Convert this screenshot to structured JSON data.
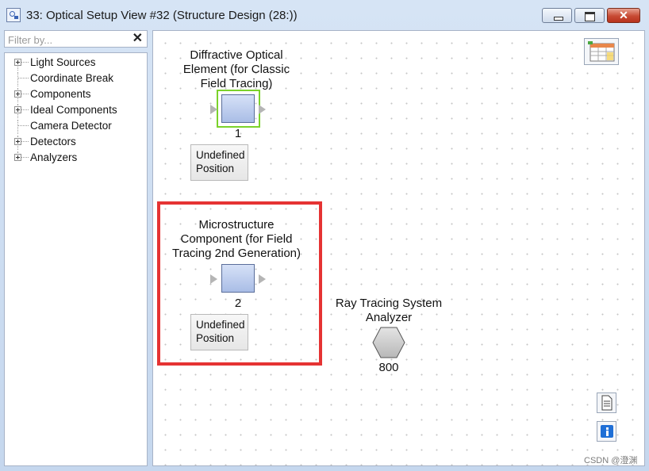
{
  "window": {
    "title": "33: Optical Setup View #32 (Structure Design (28:))",
    "buttons": {
      "minimize": "minimize",
      "maximize": "maximize",
      "close": "✕"
    }
  },
  "filter": {
    "placeholder": "Filter by...",
    "clear_symbol": "✕"
  },
  "tree": {
    "items": [
      {
        "label": "Light Sources",
        "expandable": true
      },
      {
        "label": "Coordinate Break",
        "expandable": false
      },
      {
        "label": "Components",
        "expandable": true
      },
      {
        "label": "Ideal Components",
        "expandable": true
      },
      {
        "label": "Camera Detector",
        "expandable": false
      },
      {
        "label": "Detectors",
        "expandable": true
      },
      {
        "label": "Analyzers",
        "expandable": true
      }
    ]
  },
  "canvas": {
    "components": [
      {
        "label_lines": [
          "Diffractive Optical",
          "Element (for Classic",
          "Field Tracing)"
        ],
        "number": "1",
        "position_lines": [
          "Undefined",
          "Position"
        ],
        "selected": true
      },
      {
        "label_lines": [
          "Microstructure",
          "Component (for Field",
          "Tracing 2nd Generation)"
        ],
        "number": "2",
        "position_lines": [
          "Undefined",
          "Position"
        ],
        "selected": false
      }
    ],
    "analyzer": {
      "label_lines": [
        "Ray Tracing System",
        "Analyzer"
      ],
      "number": "800"
    }
  },
  "watermark": "CSDN @澄渊",
  "colors": {
    "selection": "#7bd22a",
    "highlight": "#e53333",
    "block": "#b9cbed",
    "info_icon": "#1f6fd6"
  }
}
